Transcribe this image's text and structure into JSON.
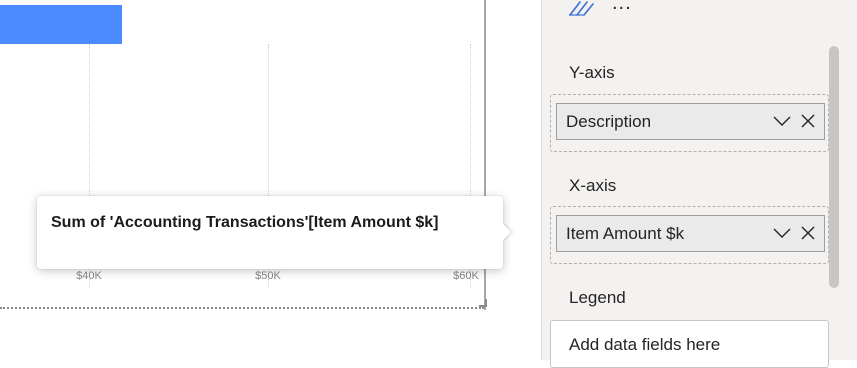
{
  "chart": {
    "bar_color": "#4a8cff",
    "ticks": [
      "$40K",
      "$50K",
      "$60K"
    ]
  },
  "tooltip": {
    "text": "Sum of 'Accounting Transactions'[Item Amount $k]"
  },
  "pane": {
    "more_label": "...",
    "y_axis": {
      "title": "Y-axis",
      "field": "Description"
    },
    "x_axis": {
      "title": "X-axis",
      "field": "Item Amount $k"
    },
    "legend": {
      "title": "Legend",
      "placeholder": "Add data fields here"
    }
  }
}
